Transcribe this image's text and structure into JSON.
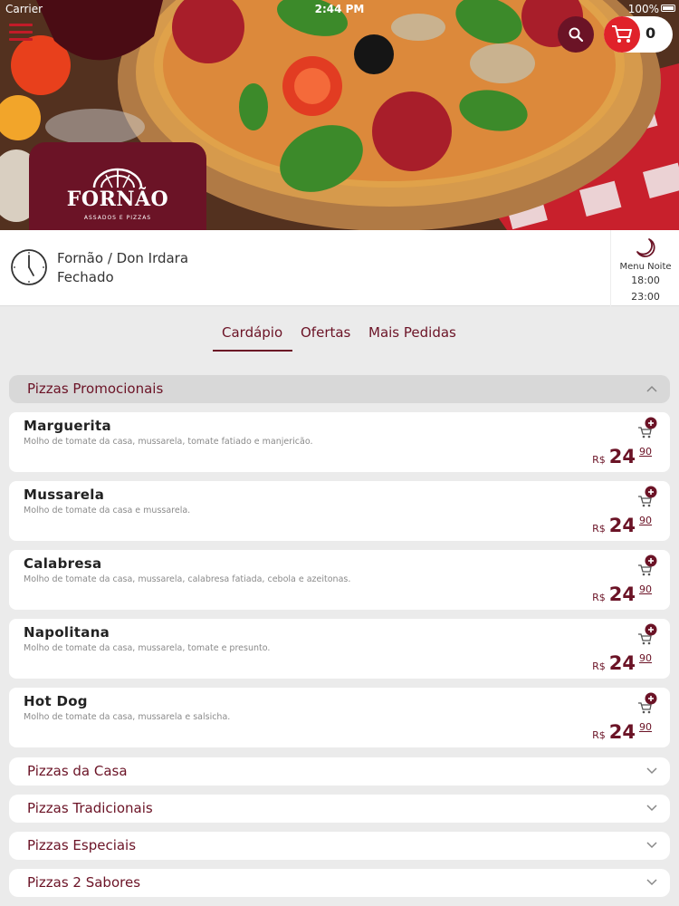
{
  "status_bar": {
    "carrier": "Carrier",
    "time": "2:44 PM",
    "battery": "100%"
  },
  "header": {
    "cart_count": "0",
    "logo_name": "FORNÃO",
    "logo_sub": "ASSADOS E PIZZAS",
    "icons": {
      "menu": "hamburger-icon",
      "search": "search-icon",
      "cart": "cart-icon"
    }
  },
  "store": {
    "name": "Fornão / Don Irdara",
    "status": "Fechado",
    "menu_label": "Menu Noite",
    "open_time": "18:00",
    "close_time": "23:00"
  },
  "tabs": [
    {
      "label": "Cardápio",
      "active": true
    },
    {
      "label": "Ofertas",
      "active": false
    },
    {
      "label": "Mais Pedidas",
      "active": false
    }
  ],
  "categories": [
    {
      "label": "Pizzas Promocionais",
      "expanded": true,
      "items": [
        {
          "name": "Marguerita",
          "description": "Molho de tomate da casa, mussarela, tomate fatiado e manjericão.",
          "currency": "R$",
          "price_int": "24",
          "price_cents": "90"
        },
        {
          "name": "Mussarela",
          "description": "Molho de tomate da casa e mussarela.",
          "currency": "R$",
          "price_int": "24",
          "price_cents": "90"
        },
        {
          "name": "Calabresa",
          "description": "Molho de tomate da casa, mussarela, calabresa fatiada, cebola e azeitonas.",
          "currency": "R$",
          "price_int": "24",
          "price_cents": "90"
        },
        {
          "name": "Napolitana",
          "description": "Molho de tomate da casa, mussarela, tomate e presunto.",
          "currency": "R$",
          "price_int": "24",
          "price_cents": "90"
        },
        {
          "name": "Hot Dog",
          "description": "Molho de tomate da casa, mussarela e salsicha.",
          "currency": "R$",
          "price_int": "24",
          "price_cents": "90"
        }
      ]
    },
    {
      "label": "Pizzas da Casa",
      "expanded": false
    },
    {
      "label": "Pizzas Tradicionais",
      "expanded": false
    },
    {
      "label": "Pizzas Especiais",
      "expanded": false
    },
    {
      "label": "Pizzas 2 Sabores",
      "expanded": false
    }
  ],
  "colors": {
    "brand": "#6b1326",
    "accent_red": "#e0222a",
    "background": "#ebebeb"
  }
}
